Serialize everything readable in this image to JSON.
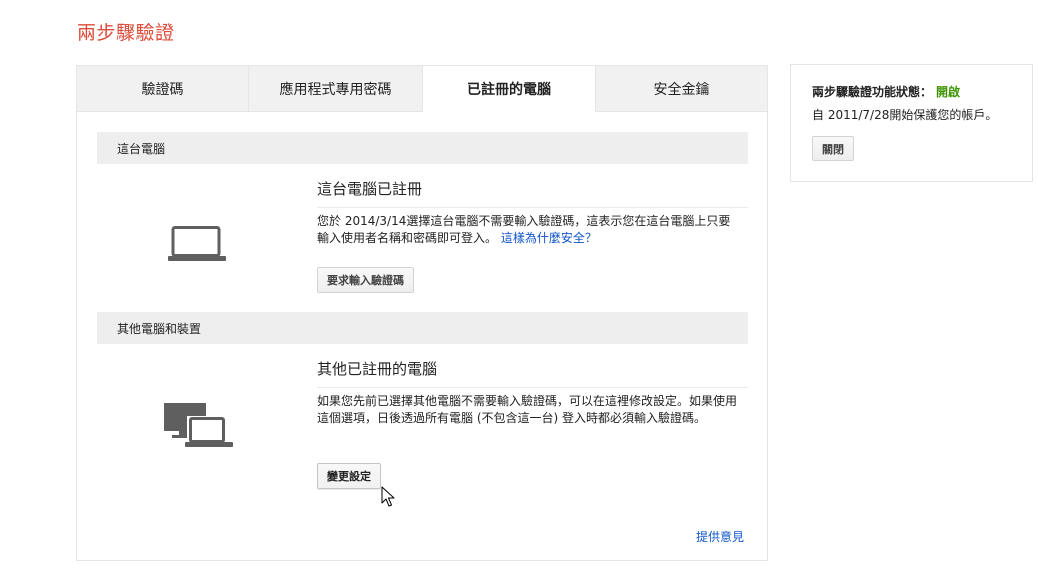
{
  "page": {
    "title": "兩步驟驗證"
  },
  "tabs": [
    {
      "label": "驗證碼",
      "active": false
    },
    {
      "label": "應用程式專用密碼",
      "active": false
    },
    {
      "label": "已註冊的電腦",
      "active": true
    },
    {
      "label": "安全金鑰",
      "active": false
    }
  ],
  "this_computer": {
    "section_header": "這台電腦",
    "title": "這台電腦已註冊",
    "description": "您於 2014/3/14選擇這台電腦不需要輸入驗證碼，這表示您在這台電腦上只要輸入使用者名稱和密碼即可登入。",
    "link_text": "這樣為什麼安全？",
    "button_label": "要求輸入驗證碼",
    "icon": "laptop-icon"
  },
  "other_computers": {
    "section_header": "其他電腦和裝置",
    "title": "其他已註冊的電腦",
    "description": "如果您先前已選擇其他電腦不需要輸入驗證碼，可以在這裡修改設定。如果使用這個選項，日後透過所有電腦 (不包含這一台) 登入時都必須輸入驗證碼。",
    "button_label": "變更設定",
    "icon": "multiple-devices-icon"
  },
  "footer": {
    "feedback_link": "提供意見"
  },
  "status": {
    "label": "兩步驟驗證功能狀態：",
    "value": "開啟",
    "since": "自 2011/7/28開始保護您的帳戶。",
    "button_label": "關閉"
  },
  "colors": {
    "title_red": "#dd4b39",
    "link_blue": "#1155cc",
    "status_green": "#3d9400",
    "icon_gray": "#5f5f5f"
  }
}
